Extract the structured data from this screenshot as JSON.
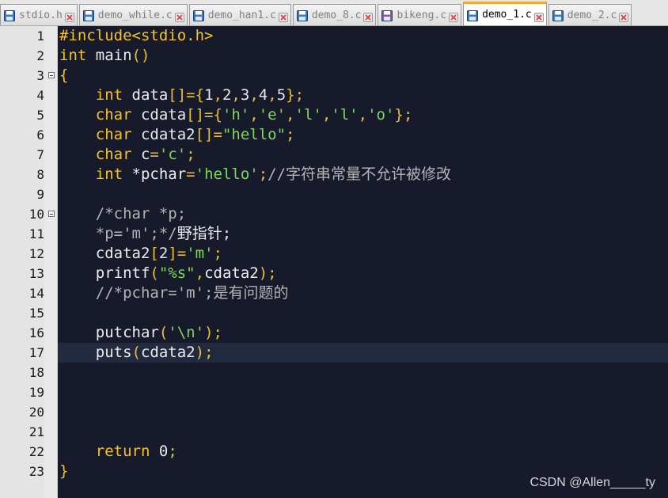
{
  "tabs": [
    {
      "label": "stdio.h",
      "icon": "floppy-save-icon",
      "modified": false,
      "active": false
    },
    {
      "label": "demo_while.c",
      "icon": "floppy-save-icon",
      "modified": false,
      "active": false
    },
    {
      "label": "demo_han1.c",
      "icon": "floppy-save-icon",
      "modified": false,
      "active": false
    },
    {
      "label": "demo_8.c",
      "icon": "floppy-save-icon",
      "modified": false,
      "active": false
    },
    {
      "label": "bikeng.c",
      "icon": "floppy-unsaved-icon",
      "modified": true,
      "active": false
    },
    {
      "label": "demo_1.c",
      "icon": "floppy-save-icon",
      "modified": false,
      "active": true
    },
    {
      "label": "demo_2.c",
      "icon": "floppy-save-icon",
      "modified": false,
      "active": false
    }
  ],
  "colors": {
    "editor_bg": "#161a2b",
    "current_line": "#222a40",
    "keyword": "#f8c320",
    "string": "#7ed85a",
    "comment": "#b4b4b4",
    "active_tab_accent": "#f4a836",
    "close_icon": "#e04040"
  },
  "current_line": 17,
  "fold_markers": [
    3,
    10
  ],
  "editor": {
    "lines": [
      {
        "no": "1",
        "tokens": [
          {
            "t": "#include<stdio.h>",
            "c": "pp"
          }
        ]
      },
      {
        "no": "2",
        "tokens": [
          {
            "t": "int",
            "c": "kw"
          },
          {
            "t": " main",
            "c": "txt"
          },
          {
            "t": "()",
            "c": "punc"
          }
        ]
      },
      {
        "no": "3",
        "tokens": [
          {
            "t": "{",
            "c": "punc"
          }
        ]
      },
      {
        "no": "4",
        "tokens": [
          {
            "t": "    ",
            "c": "txt"
          },
          {
            "t": "int",
            "c": "kw"
          },
          {
            "t": " data",
            "c": "txt"
          },
          {
            "t": "[]={",
            "c": "punc"
          },
          {
            "t": "1",
            "c": "num"
          },
          {
            "t": ",",
            "c": "punc"
          },
          {
            "t": "2",
            "c": "num"
          },
          {
            "t": ",",
            "c": "punc"
          },
          {
            "t": "3",
            "c": "num"
          },
          {
            "t": ",",
            "c": "punc"
          },
          {
            "t": "4",
            "c": "num"
          },
          {
            "t": ",",
            "c": "punc"
          },
          {
            "t": "5",
            "c": "num"
          },
          {
            "t": "};",
            "c": "punc"
          }
        ]
      },
      {
        "no": "5",
        "tokens": [
          {
            "t": "    ",
            "c": "txt"
          },
          {
            "t": "char",
            "c": "kw"
          },
          {
            "t": " cdata",
            "c": "txt"
          },
          {
            "t": "[]={",
            "c": "punc"
          },
          {
            "t": "'h'",
            "c": "str"
          },
          {
            "t": ",",
            "c": "punc"
          },
          {
            "t": "'e'",
            "c": "str"
          },
          {
            "t": ",",
            "c": "punc"
          },
          {
            "t": "'l'",
            "c": "str"
          },
          {
            "t": ",",
            "c": "punc"
          },
          {
            "t": "'l'",
            "c": "str"
          },
          {
            "t": ",",
            "c": "punc"
          },
          {
            "t": "'o'",
            "c": "str"
          },
          {
            "t": "};",
            "c": "punc"
          }
        ]
      },
      {
        "no": "6",
        "tokens": [
          {
            "t": "    ",
            "c": "txt"
          },
          {
            "t": "char",
            "c": "kw"
          },
          {
            "t": " cdata2",
            "c": "txt"
          },
          {
            "t": "[]=",
            "c": "punc"
          },
          {
            "t": "\"hello\"",
            "c": "str"
          },
          {
            "t": ";",
            "c": "punc"
          }
        ]
      },
      {
        "no": "7",
        "tokens": [
          {
            "t": "    ",
            "c": "txt"
          },
          {
            "t": "char",
            "c": "kw"
          },
          {
            "t": " c",
            "c": "txt"
          },
          {
            "t": "=",
            "c": "punc"
          },
          {
            "t": "'c'",
            "c": "str"
          },
          {
            "t": ";",
            "c": "punc"
          }
        ]
      },
      {
        "no": "8",
        "tokens": [
          {
            "t": "    ",
            "c": "txt"
          },
          {
            "t": "int",
            "c": "kw"
          },
          {
            "t": " *pchar",
            "c": "txt"
          },
          {
            "t": "=",
            "c": "punc"
          },
          {
            "t": "'hello'",
            "c": "str"
          },
          {
            "t": ";",
            "c": "punc"
          },
          {
            "t": "//字符串常量不允许被修改",
            "c": "cmt"
          }
        ]
      },
      {
        "no": "9",
        "tokens": []
      },
      {
        "no": "10",
        "tokens": [
          {
            "t": "    /*char *p;",
            "c": "cmt"
          }
        ]
      },
      {
        "no": "11",
        "tokens": [
          {
            "t": "    *p='m';*/",
            "c": "cmt"
          },
          {
            "t": "野指针;",
            "c": "txt"
          }
        ]
      },
      {
        "no": "12",
        "tokens": [
          {
            "t": "    ",
            "c": "txt"
          },
          {
            "t": "cdata2",
            "c": "txt"
          },
          {
            "t": "[",
            "c": "punc"
          },
          {
            "t": "2",
            "c": "num"
          },
          {
            "t": "]=",
            "c": "punc"
          },
          {
            "t": "'m'",
            "c": "str"
          },
          {
            "t": ";",
            "c": "punc"
          }
        ]
      },
      {
        "no": "13",
        "tokens": [
          {
            "t": "    ",
            "c": "txt"
          },
          {
            "t": "printf",
            "c": "txt"
          },
          {
            "t": "(",
            "c": "punc"
          },
          {
            "t": "\"%s\"",
            "c": "str"
          },
          {
            "t": ",",
            "c": "punc"
          },
          {
            "t": "cdata2",
            "c": "txt"
          },
          {
            "t": ");",
            "c": "punc"
          }
        ]
      },
      {
        "no": "14",
        "tokens": [
          {
            "t": "    //*pchar='m';是有问题的",
            "c": "cmt"
          }
        ]
      },
      {
        "no": "15",
        "tokens": []
      },
      {
        "no": "16",
        "tokens": [
          {
            "t": "    ",
            "c": "txt"
          },
          {
            "t": "putchar",
            "c": "txt"
          },
          {
            "t": "(",
            "c": "punc"
          },
          {
            "t": "'\\n'",
            "c": "str"
          },
          {
            "t": ");",
            "c": "punc"
          }
        ]
      },
      {
        "no": "17",
        "tokens": [
          {
            "t": "    ",
            "c": "txt"
          },
          {
            "t": "puts",
            "c": "txt"
          },
          {
            "t": "(",
            "c": "punc"
          },
          {
            "t": "cdata2",
            "c": "txt"
          },
          {
            "t": ");",
            "c": "punc"
          }
        ]
      },
      {
        "no": "18",
        "tokens": []
      },
      {
        "no": "19",
        "tokens": []
      },
      {
        "no": "20",
        "tokens": []
      },
      {
        "no": "21",
        "tokens": []
      },
      {
        "no": "22",
        "tokens": [
          {
            "t": "    ",
            "c": "txt"
          },
          {
            "t": "return",
            "c": "kw"
          },
          {
            "t": " ",
            "c": "txt"
          },
          {
            "t": "0",
            "c": "num"
          },
          {
            "t": ";",
            "c": "punc"
          }
        ]
      },
      {
        "no": "23",
        "tokens": [
          {
            "t": "}",
            "c": "punc"
          }
        ]
      }
    ]
  },
  "watermark": "CSDN @Allen_____ty"
}
